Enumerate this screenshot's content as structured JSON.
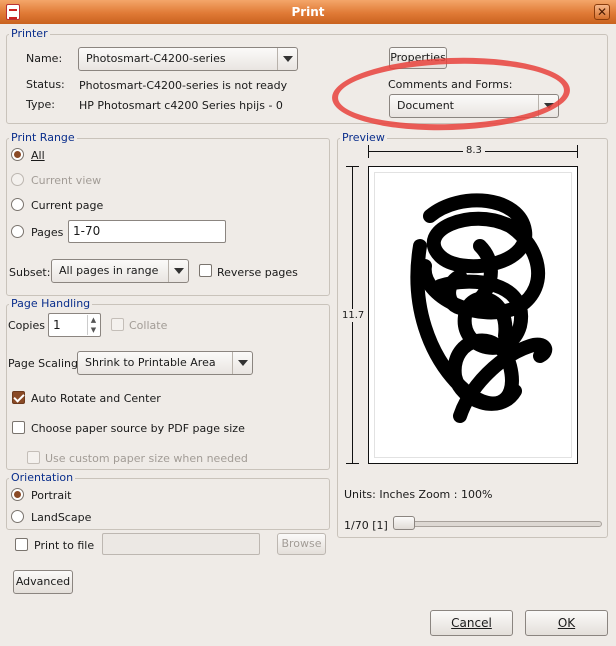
{
  "window": {
    "title": "Print"
  },
  "printer": {
    "legend": "Printer",
    "name_label": "Name:",
    "name_value": "Photosmart-C4200-series",
    "status_label": "Status:",
    "status_value": "Photosmart-C4200-series is not ready",
    "type_label": "Type:",
    "type_value": "HP Photosmart c4200 Series hpijs -  0",
    "properties_button": "Properties",
    "comments_label": "Comments and Forms:",
    "comments_value": "Document"
  },
  "print_range": {
    "legend": "Print Range",
    "all": "All",
    "current_view": "Current view",
    "current_page": "Current page",
    "pages": "Pages",
    "pages_value": "1-70",
    "subset_label": "Subset:",
    "subset_value": "All pages in range",
    "reverse_pages": "Reverse pages"
  },
  "page_handling": {
    "legend": "Page Handling",
    "copies_label": "Copies",
    "copies_value": "1",
    "collate": "Collate",
    "scaling_label": "Page Scaling",
    "scaling_value": "Shrink to Printable Area",
    "auto_rotate": "Auto Rotate and Center",
    "paper_source": "Choose paper source by PDF page size",
    "custom_paper": "Use custom paper size when needed"
  },
  "orientation": {
    "legend": "Orientation",
    "portrait": "Portrait",
    "landscape": "LandScape"
  },
  "print_to_file": {
    "label": "Print to file",
    "path": "",
    "browse_button": "Browse"
  },
  "preview": {
    "legend": "Preview",
    "width": "8.3",
    "height": "11.7",
    "units_text": "Units: Inches Zoom : 100%",
    "page_indicator": "1/70  [1]",
    "page_fraction": 0.0
  },
  "buttons": {
    "advanced": "Advanced",
    "cancel": "Cancel",
    "ok": "OK"
  },
  "colors": {
    "accent": "#e07a36",
    "legend": "#0a2e8c",
    "checked": "#8a4a26",
    "annotation": "#e8423c"
  }
}
